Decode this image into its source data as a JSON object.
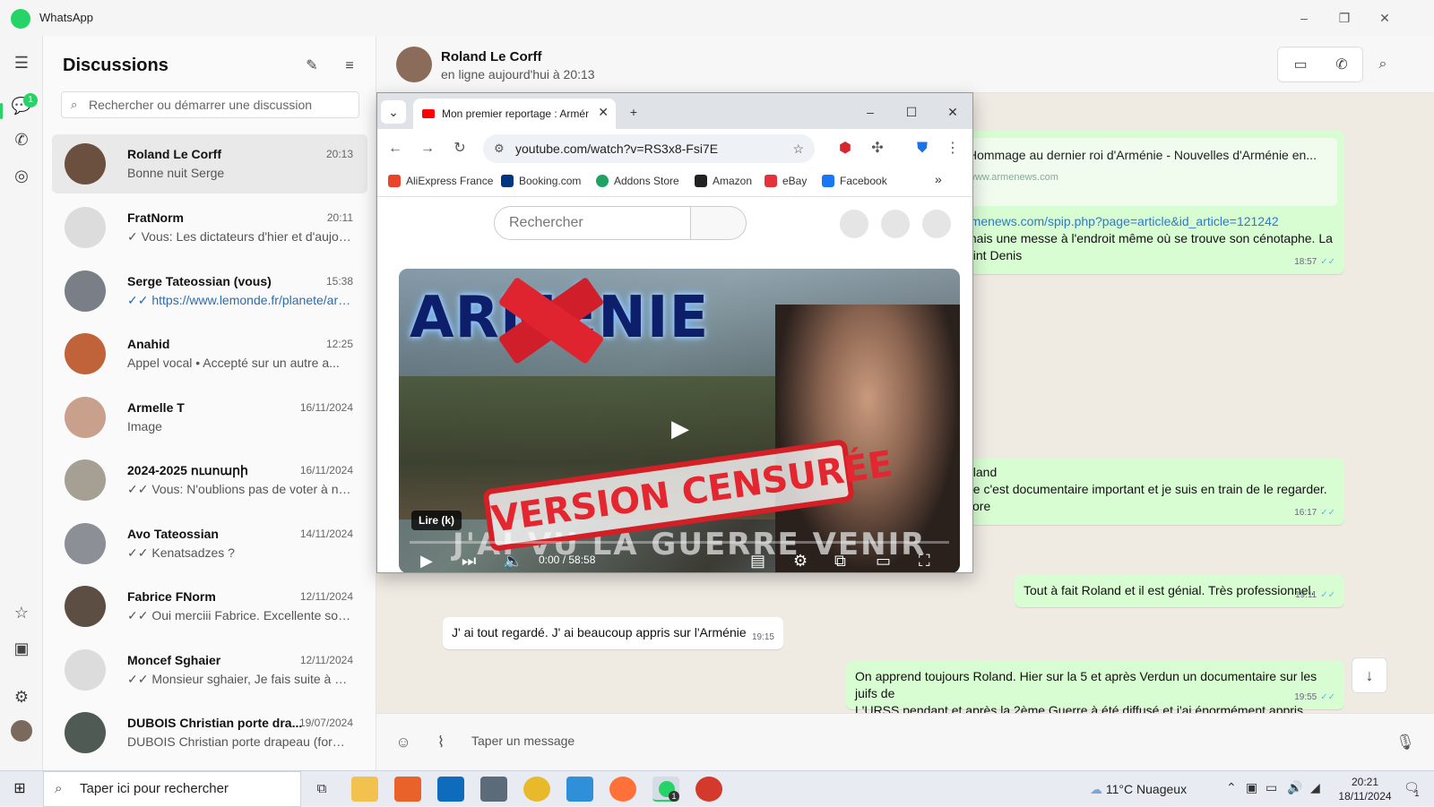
{
  "app": {
    "title": "WhatsApp",
    "brand_color": "#25d366"
  },
  "window_controls": {
    "minimize": "–",
    "restore": "❐",
    "close": "✕"
  },
  "rail": {
    "chats_badge": "1"
  },
  "sidebar": {
    "title": "Discussions",
    "search_placeholder": "Rechercher ou démarrer une discussion",
    "chats": [
      {
        "name": "Roland Le Corff",
        "time": "20:13",
        "preview": "Bonne nuit Serge",
        "avatar_color": "#6b4f3f"
      },
      {
        "name": "FratNorm",
        "time": "20:11",
        "preview": "✓ Vous: Les dictateurs d'hier et d'aujou...",
        "avatar_color": "#dcdcdc"
      },
      {
        "name": "Serge Tateossian (vous)",
        "time": "15:38",
        "preview": "✓✓ https://www.lemonde.fr/planete/arti...",
        "avatar_color": "#7a7e86"
      },
      {
        "name": "Anahid",
        "time": "12:25",
        "preview": "Appel vocal • Accepté sur un autre a...",
        "avatar_color": "#c0633a"
      },
      {
        "name": "Armelle T",
        "time": "16/11/2024",
        "preview": "Image",
        "avatar_color": "#c9a08c"
      },
      {
        "name": "2024-2025 ուսոարի",
        "time": "16/11/2024",
        "preview": "✓✓ Vous: N'oublions pas de voter à  not...",
        "avatar_color": "#a59f94"
      },
      {
        "name": "Avo Tateossian",
        "time": "14/11/2024",
        "preview": "✓✓ Kenatsadzes ?",
        "avatar_color": "#8d8f96"
      },
      {
        "name": "Fabrice FNorm",
        "time": "12/11/2024",
        "preview": "✓✓ Oui merciii Fabrice. Excellente soirée",
        "avatar_color": "#5d4e44"
      },
      {
        "name": "Moncef Sghaier",
        "time": "12/11/2024",
        "preview": "✓✓ Monsieur sghaier, Je fais suite à  vot...",
        "avatar_color": "#dcdcdc"
      },
      {
        "name": "DUBOIS Christian porte dra...",
        "time": "19/07/2024",
        "preview": "DUBOIS Christian porte drapeau (forma...",
        "avatar_color": "#4f5a55"
      }
    ]
  },
  "conversation": {
    "contact_name": "Roland Le Corff",
    "status": "en ligne aujourd'hui à 20:13",
    "link_card": {
      "title": "Hommage au dernier roi d'Arménie - Nouvelles d'Arménie en...",
      "domain": "www.armenews.com"
    },
    "messages": [
      {
        "lines": [
          "rmenews.com/spip.php?page=article&id_article=121242",
          "mais une messe à  l'endroit même où se trouve son cénotaphe. La",
          "aint Denis"
        ],
        "time": "18:57",
        "dir": "out"
      },
      {
        "lines": [
          "oland",
          "ue c'est documentaire important et je suis en train de le regarder.",
          "core"
        ],
        "time": "16:17",
        "dir": "out"
      },
      {
        "lines": [
          "Tout à fait Roland et il est génial. Très professionnel."
        ],
        "time": "19:11",
        "dir": "out"
      },
      {
        "lines": [
          "J' ai tout regardé. J' ai beaucoup appris sur l'Arménie"
        ],
        "time": "19:15",
        "dir": "in"
      },
      {
        "lines": [
          "On apprend toujours Roland. Hier sur la 5 et après Verdun un documentaire sur les juifs de",
          "L'URSS pendant et après  la 2ème Guerre à été diffusé et j'ai énormément appris."
        ],
        "time": "19:55",
        "dir": "out"
      }
    ],
    "composer_placeholder": "Taper un message"
  },
  "browser": {
    "tab_title": "Mon premier reportage : Arménie",
    "url": "youtube.com/watch?v=RS3x8-Fsi7E",
    "bookmarks": [
      {
        "label": "AliExpress France",
        "color": "#e8432b"
      },
      {
        "label": "Booking.com",
        "color": "#003580"
      },
      {
        "label": "Addons Store",
        "color": "#1ea362"
      },
      {
        "label": "Amazon",
        "color": "#222222"
      },
      {
        "label": "eBay",
        "color": "#e53238"
      },
      {
        "label": "Facebook",
        "color": "#1877f2"
      }
    ],
    "yt_search_placeholder": "Rechercher",
    "video": {
      "title_text": "ARMÉNIE",
      "stamp_text": "VERSION CENSURÉE",
      "subtitle_text": "J'AI VU LA GUERRE VENIR",
      "tooltip": "Lire (k)",
      "time": "0:00 / 58:58",
      "progress": 0
    }
  },
  "taskbar": {
    "search_placeholder": "Taper ici pour rechercher",
    "weather": "11°C  Nuageux",
    "time": "20:21",
    "date": "18/11/2024",
    "whatsapp_badge": "1",
    "notification_count": "1"
  }
}
